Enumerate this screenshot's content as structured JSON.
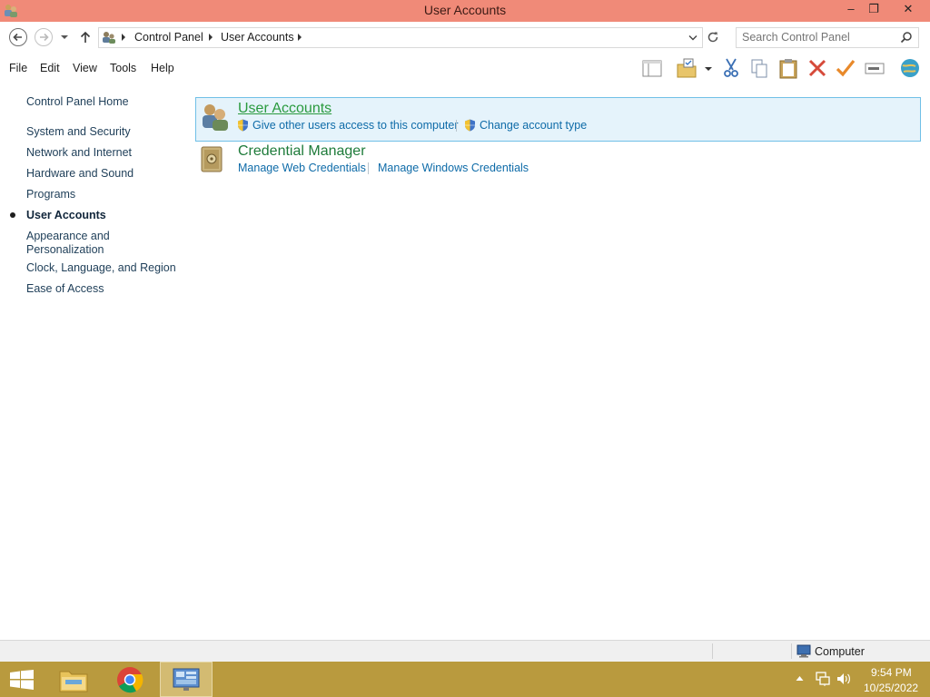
{
  "window": {
    "title": "User Accounts"
  },
  "caption": {
    "minimize": "–",
    "restore": "❐",
    "close": "✕"
  },
  "address": {
    "crumb1": "Control Panel",
    "crumb2": "User Accounts",
    "search_placeholder": "Search Control Panel"
  },
  "menu": [
    "File",
    "Edit",
    "View",
    "Tools",
    "Help"
  ],
  "left_nav": {
    "home": "Control Panel Home",
    "items": [
      "System and Security",
      "Network and Internet",
      "Hardware and Sound",
      "Programs",
      "User Accounts",
      "Appearance and",
      "Personalization",
      "Clock, Language, and Region",
      "Ease of Access"
    ],
    "active_index": 4
  },
  "categories": {
    "user_accounts": {
      "title": "User Accounts",
      "link1": "Give other users access to this computer",
      "link2": "Change account type"
    },
    "credential_manager": {
      "title": "Credential Manager",
      "link1": "Manage Web Credentials",
      "link2": "Manage Windows Credentials"
    }
  },
  "status": {
    "zone": "Computer"
  },
  "tray": {
    "time": "9:54 PM",
    "date": "10/25/2022"
  },
  "colors": {
    "titlebar": "#f08a78",
    "taskbar": "#b99a3e",
    "link": "#0e6ba8",
    "category_title": "#1e7b3a"
  }
}
